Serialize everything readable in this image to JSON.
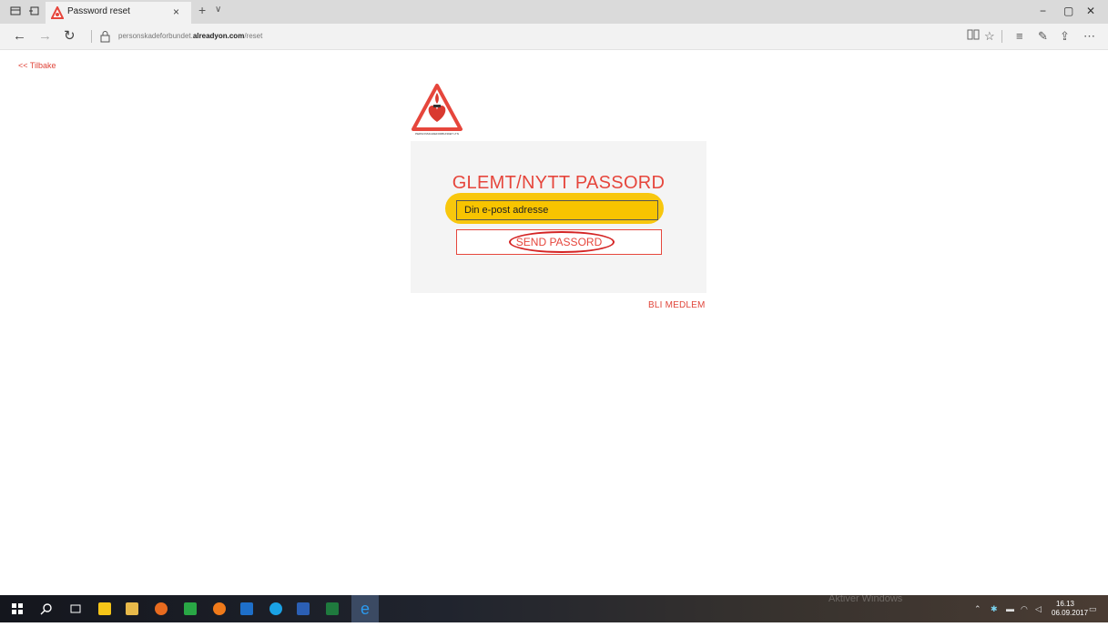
{
  "browser": {
    "tab_title": "Password reset",
    "tab_close": "×",
    "new_tab": "+",
    "tab_dropdown": "∨",
    "url_prefix": "personskadeforbundet.",
    "url_domain": "alreadyon.com",
    "url_path": "/reset",
    "icons": [
      "tab-preview-icon",
      "set-aside-tabs-icon",
      "back-icon",
      "forward-icon",
      "refresh-icon",
      "lock-icon",
      "reading-view-icon",
      "favorite-star-icon",
      "hub-icon",
      "web-note-icon",
      "share-icon",
      "more-icon"
    ]
  },
  "window": {
    "minimize": "−",
    "restore": "▢",
    "close": "✕"
  },
  "page": {
    "back_link": "<< Tilbake",
    "logo_caption": "PERSONSKADEFORBUNDET LTN",
    "heading": "GLEMT/NYTT PASSORD",
    "email_placeholder": "Din e-post adresse",
    "send_button": "SEND PASSORD",
    "join_link": "BLI MEDLEM"
  },
  "colors": {
    "accent": "#e6463c",
    "highlight": "#f8c400",
    "circle_annotation": "#d42424",
    "panel": "#f4f4f4"
  },
  "taskbar": {
    "time": "16.13",
    "date": "06.09.2017",
    "watermark": "Aktiver Windows"
  }
}
